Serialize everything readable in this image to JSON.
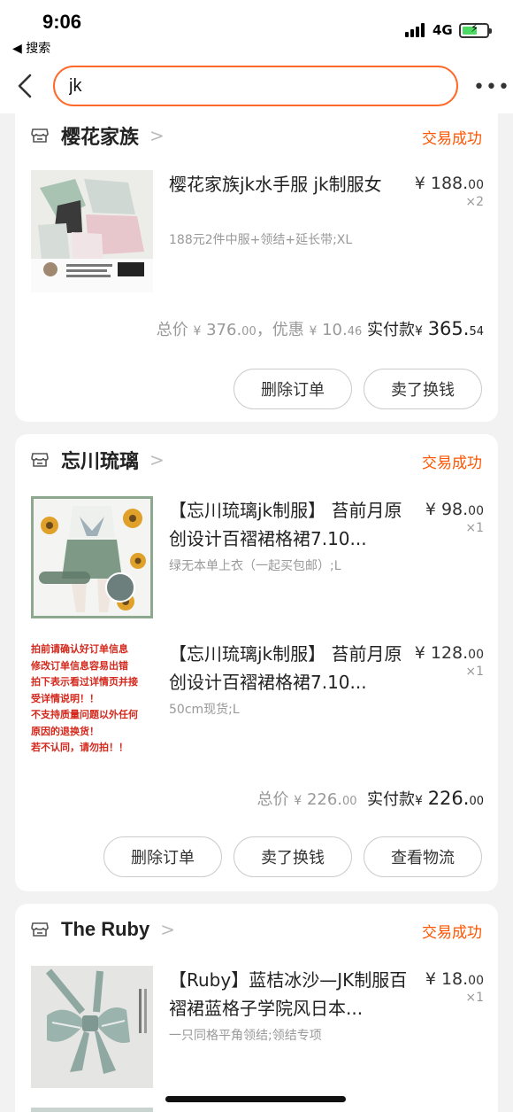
{
  "status_bar": {
    "time": "9:06",
    "back_app": "◀ 搜索",
    "network": "4G",
    "battery_level": 0.6
  },
  "search": {
    "query": "jk",
    "more_icon": "more-horizontal-icon"
  },
  "orders": [
    {
      "shop_name": "樱花家族",
      "status": "交易成功",
      "items": [
        {
          "title": "樱花家族jk水手服 jk制服女",
          "spec": "188元2件中服+领结+延长带;XL",
          "price_main": "¥ 188.",
          "price_dec": "00",
          "qty": "×2"
        }
      ],
      "total_label": "总价",
      "total_yen": "¥",
      "total_main": "376.",
      "total_dec": "00",
      "discount_label": "，优惠",
      "discount_yen": "¥",
      "discount_main": "10.",
      "discount_dec": "46",
      "paid_label": "实付款",
      "paid_yen": "¥",
      "paid_main": "365.",
      "paid_dec": "54",
      "buttons": [
        "删除订单",
        "卖了换钱"
      ]
    },
    {
      "shop_name": "忘川琉璃",
      "status": "交易成功",
      "items": [
        {
          "title": "【忘川琉璃jk制服】 苔前月原创设计百褶裙格裙7.10...",
          "spec": "绿无本单上衣（一起买包邮）;L",
          "price_main": "¥ 98.",
          "price_dec": "00",
          "qty": "×1"
        },
        {
          "title": "【忘川琉璃jk制服】 苔前月原创设计百褶裙格裙7.10...",
          "spec": "50cm现货;L",
          "price_main": "¥ 128.",
          "price_dec": "00",
          "qty": "×1",
          "notice_lines": [
            "拍前请确认好订单信息",
            "修改订单信息容易出错",
            "拍下表示看过详情页并接",
            "受详情说明！！",
            "不支持质量问题以外任何",
            "原因的退换货！",
            "若不认同，请勿拍！！"
          ]
        }
      ],
      "total_label": "总价",
      "total_yen": "¥",
      "total_main": "226.",
      "total_dec": "00",
      "paid_label": "实付款",
      "paid_yen": "¥",
      "paid_main": "226.",
      "paid_dec": "00",
      "buttons": [
        "删除订单",
        "卖了换钱",
        "查看物流"
      ]
    },
    {
      "shop_name": "The Ruby",
      "status": "交易成功",
      "items": [
        {
          "title": "【Ruby】蓝桔冰沙—JK制服百褶裙蓝格子学院风日本...",
          "spec": "一只同格平角领结;领结专项",
          "price_main": "¥ 18.",
          "price_dec": "00",
          "qty": "×1"
        }
      ]
    }
  ],
  "colors": {
    "accent": "#ff5500",
    "search_border": "#ff6a2a",
    "notice_red": "#d4281c"
  }
}
